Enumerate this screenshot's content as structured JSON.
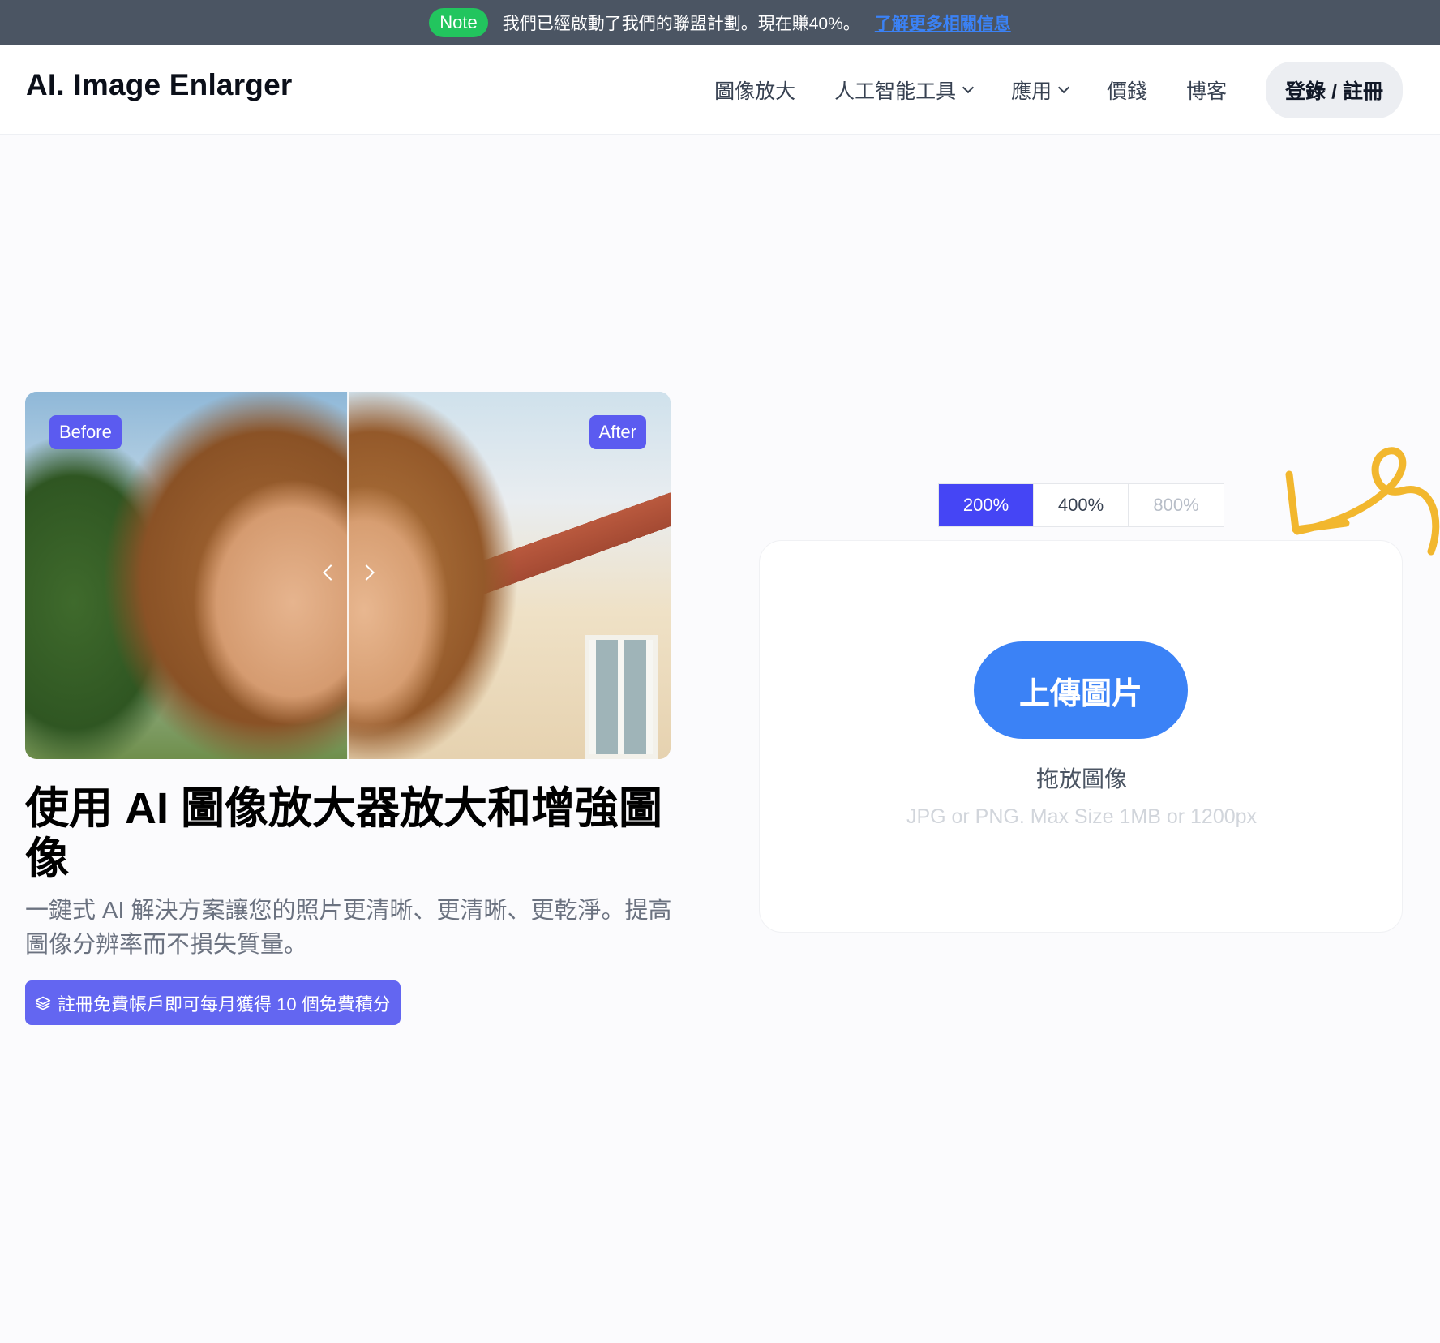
{
  "announcement": {
    "badge": "Note",
    "message": "我們已經啟動了我們的聯盟計劃。現在賺40%。",
    "link": "了解更多相關信息"
  },
  "header": {
    "logo": "AI. Image Enlarger",
    "nav": [
      "圖像放大",
      "人工智能工具",
      "應用",
      "價錢",
      "博客"
    ],
    "login": "登錄 / 註冊"
  },
  "compare": {
    "before_label": "Before",
    "after_label": "After"
  },
  "hero": {
    "headline": "使用 AI 圖像放大器放大和增強圖像",
    "subtext": "一鍵式 AI 解決方案讓您的照片更清晰、更清晰、更乾淨。提高圖像分辨率而不損失質量。",
    "signup": "註冊免費帳戶即可每月獲得 10 個免費積分"
  },
  "scale": {
    "options": [
      "200%",
      "400%",
      "800%"
    ],
    "selected": "200%"
  },
  "upload": {
    "button": "上傳圖片",
    "drop": "拖放圖像",
    "hint": "JPG or PNG. Max Size 1MB or 1200px"
  },
  "colors": {
    "accent": "#4545f5",
    "upload": "#3b82f6",
    "note": "#22c55e",
    "doodle": "#f2b72e"
  }
}
